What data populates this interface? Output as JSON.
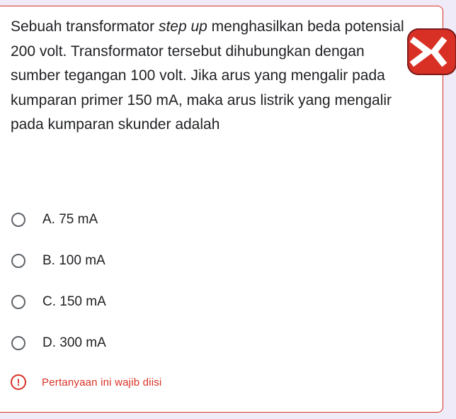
{
  "question": {
    "part1": "Sebuah transformator ",
    "emphasis": "step up",
    "part2": " menghasilkan beda potensial 200 volt. Transformator tersebut dihubungkan dengan sumber tegangan 100 volt. Jika arus yang mengalir pada kumparan primer 150 mA, maka arus listrik yang mengalir pada kumparan skunder adalah"
  },
  "options": [
    {
      "label": "A. 75 mA",
      "selected": false
    },
    {
      "label": "B. 100 mA",
      "selected": false
    },
    {
      "label": "C. 150 mA",
      "selected": false
    },
    {
      "label": "D. 300 mA",
      "selected": false
    }
  ],
  "required": {
    "icon": "exclamation-icon",
    "text": "Pertanyaan ini wajib diisi"
  },
  "colors": {
    "error": "#d93025",
    "text": "#202124",
    "background": "#f0ebf8"
  }
}
